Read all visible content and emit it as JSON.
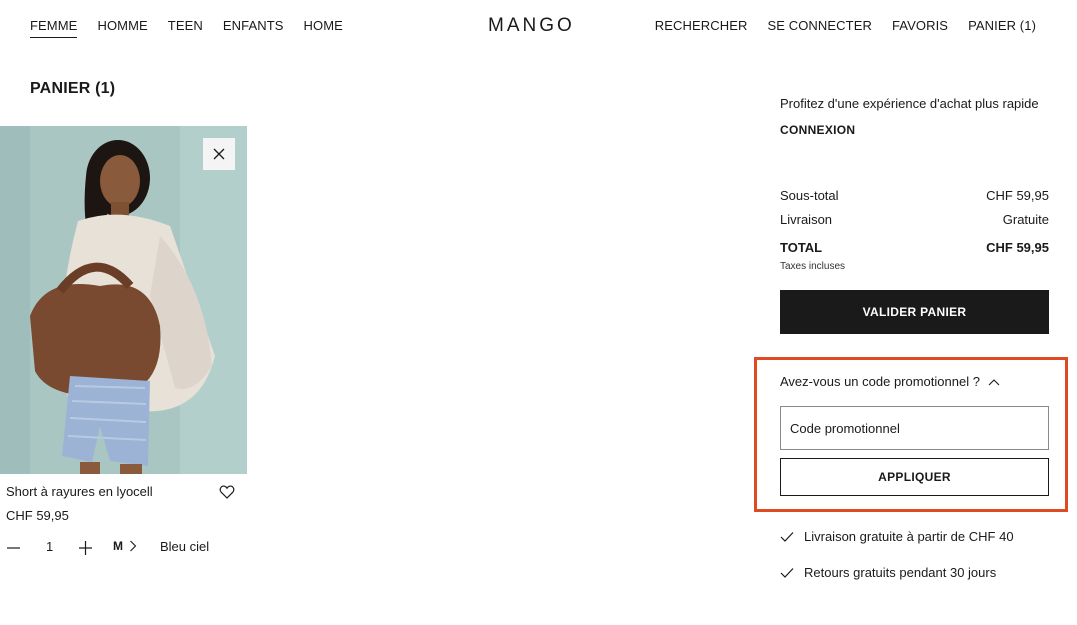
{
  "header": {
    "nav_left": [
      "FEMME",
      "HOMME",
      "TEEN",
      "ENFANTS",
      "HOME"
    ],
    "logo": "MANGO",
    "nav_right": [
      "RECHERCHER",
      "SE CONNECTER",
      "FAVORIS",
      "PANIER (1)"
    ]
  },
  "page_title": "PANIER (1)",
  "product": {
    "name": "Short à rayures en lyocell",
    "price": "CHF 59,95",
    "quantity": "1",
    "size": "M",
    "color": "Bleu ciel"
  },
  "summary": {
    "promo_text": "Profitez d'une expérience d'achat plus rapide",
    "connexion": "CONNEXION",
    "subtotal_label": "Sous-total",
    "subtotal_value": "CHF 59,95",
    "delivery_label": "Livraison",
    "delivery_value": "Gratuite",
    "total_label": "TOTAL",
    "total_value": "CHF 59,95",
    "taxes": "Taxes incluses",
    "checkout": "VALIDER PANIER",
    "promo_question": "Avez-vous un code promotionnel ?",
    "promo_placeholder": "Code promotionnel",
    "apply": "APPLIQUER",
    "benefit_1": "Livraison gratuite à partir de CHF 40",
    "benefit_2": "Retours gratuits pendant 30 jours"
  },
  "colors": {
    "highlight": "#e04a22",
    "button_dark": "#1a1a1a",
    "image_bg": "#a9c6c3"
  }
}
